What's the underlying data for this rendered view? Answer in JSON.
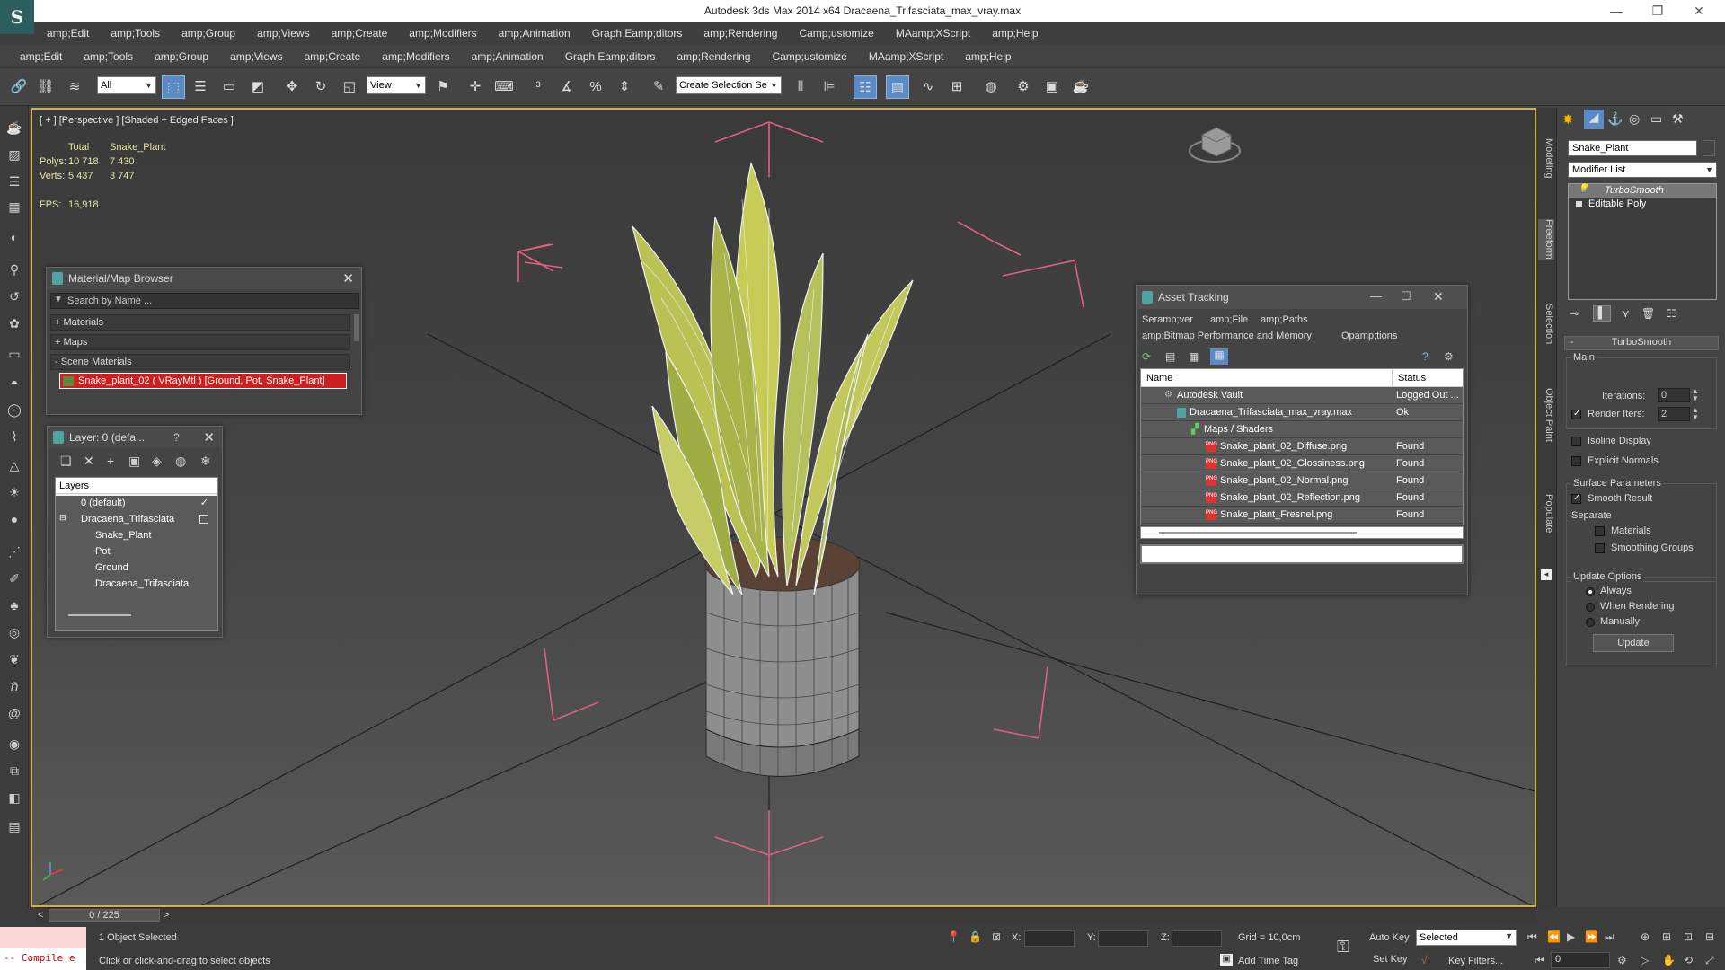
{
  "window": {
    "title": "Autodesk 3ds Max  2014 x64     Dracaena_Trifasciata_max_vray.max",
    "minimize": "—",
    "maximize": "❐",
    "close": "✕"
  },
  "menu1": [
    "amp;Edit",
    "amp;Tools",
    "amp;Group",
    "amp;Views",
    "amp;Create",
    "amp;Modifiers",
    "amp;Animation",
    "Graph Eamp;ditors",
    "amp;Rendering",
    "Camp;ustomize",
    "MAamp;XScript",
    "amp;Help"
  ],
  "menu2": [
    "amp;Edit",
    "amp;Tools",
    "amp;Group",
    "amp;Views",
    "amp;Create",
    "amp;Modifiers",
    "amp;Animation",
    "Graph Eamp;ditors",
    "amp;Rendering",
    "Camp;ustomize",
    "MAamp;XScript",
    "amp;Help"
  ],
  "toolbar": {
    "selection_filter": "All",
    "ref_coord": "View",
    "named_selection": "Create Selection Se"
  },
  "viewport": {
    "label": "[ + ] [Perspective ] [Shaded + Edged Faces ]",
    "stats_total": "Total",
    "stats_object": "Snake_Plant",
    "polys_label": "Polys:",
    "polys_total": "10 718",
    "polys_object": "7 430",
    "verts_label": "Verts:",
    "verts_total": "5 437",
    "verts_object": "3 747",
    "fps_label": "FPS:",
    "fps_value": "16,918"
  },
  "material_browser": {
    "title": "Material/Map Browser",
    "search_placeholder": "Search by Name ...",
    "sections": [
      "+ Materials",
      "+ Maps",
      "- Scene Materials"
    ],
    "selected_material": "Snake_plant_02  ( VRayMtl )  [Ground, Pot, Snake_Plant]"
  },
  "layer_window": {
    "title": "Layer: 0 (defa...",
    "help": "?",
    "header": "Layers",
    "items": [
      "0 (default)",
      "Dracaena_Trifasciata",
      "Snake_Plant",
      "Pot",
      "Ground",
      "Dracaena_Trifasciata"
    ]
  },
  "asset_tracking": {
    "title": "Asset Tracking",
    "menu": [
      "Seramp;ver",
      "amp;File",
      "amp;Paths",
      "amp;Bitmap Performance and Memory",
      "Opamp;tions"
    ],
    "col_name": "Name",
    "col_status": "Status",
    "rows": [
      {
        "name": "Autodesk Vault",
        "status": "Logged Out ..."
      },
      {
        "name": "Dracaena_Trifasciata_max_vray.max",
        "status": "Ok"
      },
      {
        "name": "Maps / Shaders",
        "status": ""
      },
      {
        "name": "Snake_plant_02_Diffuse.png",
        "status": "Found"
      },
      {
        "name": "Snake_plant_02_Glossiness.png",
        "status": "Found"
      },
      {
        "name": "Snake_plant_02_Normal.png",
        "status": "Found"
      },
      {
        "name": "Snake_plant_02_Reflection.png",
        "status": "Found"
      },
      {
        "name": "Snake_plant_Fresnel.png",
        "status": "Found"
      }
    ]
  },
  "side_tabs": [
    "Modeling",
    "Freeform",
    "Selection",
    "Object Paint",
    "Populate"
  ],
  "command_panel": {
    "object_name": "Snake_Plant",
    "modifier_list": "Modifier List",
    "stack": [
      "TurboSmooth",
      "Editable Poly"
    ],
    "rollout_title": "TurboSmooth",
    "main_label": "Main",
    "iterations_label": "Iterations:",
    "iterations_value": "0",
    "render_iters_label": "Render Iters:",
    "render_iters_value": "2",
    "isoline_label": "Isoline Display",
    "explicit_normals_label": "Explicit Normals",
    "surface_params_label": "Surface Parameters",
    "smooth_result_label": "Smooth Result",
    "separate_label": "Separate",
    "materials_label": "Materials",
    "smoothing_groups_label": "Smoothing Groups",
    "update_options_label": "Update Options",
    "always_label": "Always",
    "when_rendering_label": "When Rendering",
    "manually_label": "Manually",
    "update_button": "Update"
  },
  "timeline": {
    "frame": "0 / 225",
    "prev": "<",
    "next": ">"
  },
  "status": {
    "maxscript": "-- Compile e",
    "selected": "1 Object Selected",
    "prompt": "Click or click-and-drag to select objects",
    "x_label": "X:",
    "y_label": "Y:",
    "z_label": "Z:",
    "grid": "Grid = 10,0cm",
    "add_time_tag": "Add Time Tag",
    "auto_key": "Auto Key",
    "set_key": "Set Key",
    "key_mode": "Selected",
    "key_filters": "Key Filters...",
    "frame_field": "0"
  }
}
